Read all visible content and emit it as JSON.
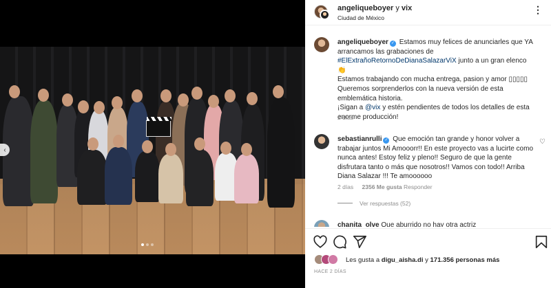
{
  "header": {
    "username": "angeliqueboyer",
    "connector": "y",
    "collaborator": "vix",
    "location": "Ciudad de México",
    "more_icon": "more-horizontal-icon"
  },
  "media": {
    "carousel_dots": 3,
    "active_dot": 1,
    "photo_alt": "cast group photo"
  },
  "caption": {
    "username": "angeliqueboyer",
    "line1": "Estamos muy felices de anunciarles que YA arrancamos las grabaciones de",
    "hashtag": "#ElExtrañoRetornoDeDianaSalazarViX",
    "line2": "junto a un gran elenco 👏",
    "line3": "Estamos trabajando con mucha entrega, pasion y amor",
    "line3_emojis": "▯▯▯▯▯",
    "line4": "Queremos sorprenderlos con la nueva versión de esta emblemática historia.",
    "line5_a": "¡Sigan a",
    "mention": "@vix",
    "line5_b": "y estén pendientes de todos los detalles de esta enorme producción!",
    "time": "2 días"
  },
  "comments": [
    {
      "username": "sebastianrulli",
      "text": "Que emoción tan grande y honor volver a trabajar juntos Mi Amooorr!! En este proyecto vas a lucirte como nunca antes! Estoy feliz y pleno!! Seguro de que la gente disfrutara tanto o más que nosotros!! Vamos con todo!! Arriba Diana Salazar !!! Te amoooooo",
      "time": "2 días",
      "likes": "2356 Me gusta",
      "reply": "Responder",
      "view_replies": "Ver respuestas (52)"
    },
    {
      "username": "chanita_olve",
      "text": "Que aburrido no hay otra actriz"
    }
  ],
  "likes": {
    "prefix": "Les gusta a",
    "user": "digu_aisha.di",
    "connector": "y",
    "others": "171.356 personas más"
  },
  "date": "HACE 2 DÍAS"
}
